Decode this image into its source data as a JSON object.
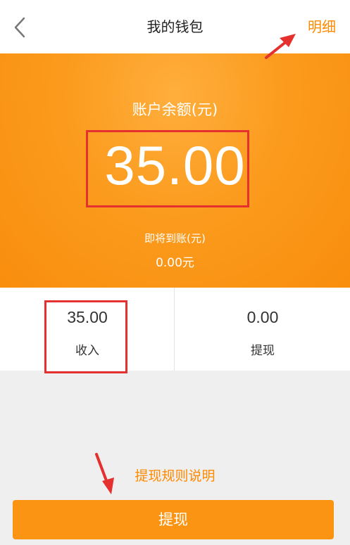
{
  "header": {
    "title": "我的钱包",
    "detail_link": "明细"
  },
  "wallet": {
    "balance_label": "账户余额(元)",
    "balance": "35.00",
    "pending_label": "即将到账(元)",
    "pending_value": "0.00元"
  },
  "stats": [
    {
      "value": "35.00",
      "label": "收入"
    },
    {
      "value": "0.00",
      "label": "提现"
    }
  ],
  "footer": {
    "rules_link": "提现规则说明",
    "withdraw_button": "提现"
  },
  "colors": {
    "accent": "#ff8a00",
    "hero": "#fb9b1d",
    "annotation": "#e53030"
  },
  "icons": {
    "back": "chevron-left-icon"
  }
}
